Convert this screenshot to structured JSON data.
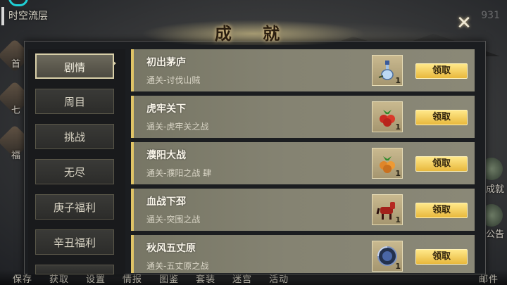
{
  "top_left_title": "时空流层",
  "top_right_text": "931",
  "left_edge_labels": [
    "首",
    "七",
    "福"
  ],
  "right_edge_labels": [
    "成就",
    "公告"
  ],
  "bottom_bar": [
    "保存",
    "获取",
    "设置",
    "情报",
    "图鉴",
    "套装",
    "迷宫",
    "活动",
    "邮件"
  ],
  "modal": {
    "title": "成 就",
    "close_symbol": "✕"
  },
  "nav": {
    "items": [
      {
        "label": "剧情",
        "active": true
      },
      {
        "label": "周目",
        "active": false
      },
      {
        "label": "挑战",
        "active": false
      },
      {
        "label": "无尽",
        "active": false
      },
      {
        "label": "庚子福利",
        "active": false
      },
      {
        "label": "辛丑福利",
        "active": false
      }
    ]
  },
  "achievements": [
    {
      "title": "初出茅庐",
      "subtitle": "通关-讨伐山贼",
      "reward_icon": "potion-icon",
      "count": "1",
      "button": "领取"
    },
    {
      "title": "虎牢关下",
      "subtitle": "通关-虎牢关之战",
      "reward_icon": "red-fruit-icon",
      "count": "1",
      "button": "领取"
    },
    {
      "title": "濮阳大战",
      "subtitle": "通关-濮阳之战 肆",
      "reward_icon": "orange-fruit-icon",
      "count": "1",
      "button": "领取"
    },
    {
      "title": "血战下邳",
      "subtitle": "通关-突围之战",
      "reward_icon": "red-horse-icon",
      "count": "1",
      "button": "领取"
    },
    {
      "title": "秋风五丈原",
      "subtitle": "通关-五丈原之战",
      "reward_icon": "blue-shield-icon",
      "count": "1",
      "button": "领取"
    }
  ],
  "colors": {
    "accent_gold": "#e0c467",
    "button_yellow": "#f2cf55",
    "card_bg": "#858372"
  }
}
